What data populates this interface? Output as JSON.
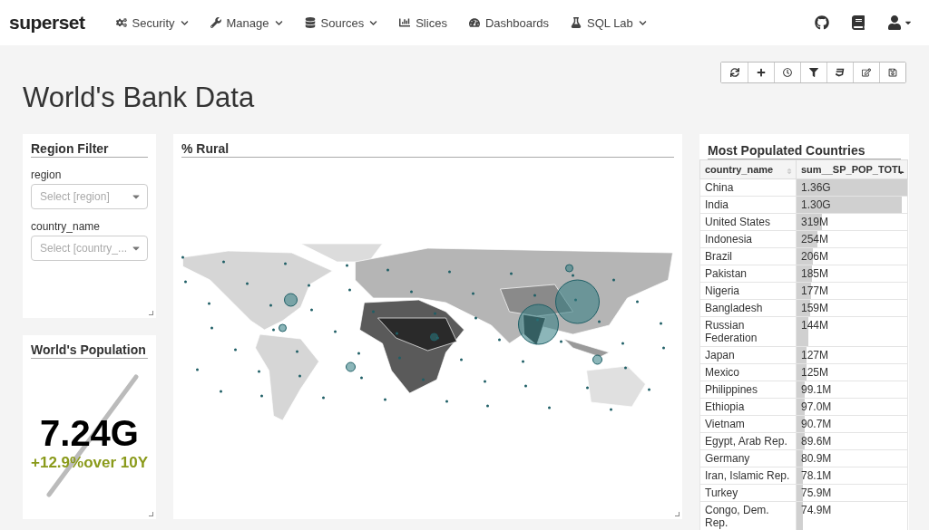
{
  "navbar": {
    "brand": "superset",
    "menu": [
      {
        "kind": "cogs",
        "label": "Security",
        "dropdown": true
      },
      {
        "kind": "wrench",
        "label": "Manage",
        "dropdown": true
      },
      {
        "kind": "database",
        "label": "Sources",
        "dropdown": true
      },
      {
        "kind": "chart",
        "label": "Slices",
        "dropdown": false
      },
      {
        "kind": "gauge",
        "label": "Dashboards",
        "dropdown": false
      },
      {
        "kind": "flask",
        "label": "SQL Lab",
        "dropdown": true
      }
    ]
  },
  "dashboard": {
    "title": "World's Bank Data"
  },
  "region_filter": {
    "title": "Region Filter",
    "fields": [
      {
        "label": "region",
        "placeholder": "Select [region]"
      },
      {
        "label": "country_name",
        "placeholder": "Select [country_..."
      }
    ]
  },
  "big_number": {
    "title": "World's Population",
    "value": "7.24G",
    "change": "+12.9%over 10Y"
  },
  "map": {
    "title": "% Rural"
  },
  "table": {
    "title": "Most Populated Countries",
    "columns": [
      "country_name",
      "sum__SP_POP_TOTL"
    ],
    "rows": [
      {
        "country": "China",
        "value": "1.36G",
        "level": 1
      },
      {
        "country": "India",
        "value": "1.30G",
        "level": 0.95
      },
      {
        "country": "United States",
        "value": "319M",
        "level": 0.23
      },
      {
        "country": "Indonesia",
        "value": "254M",
        "level": 0.19
      },
      {
        "country": "Brazil",
        "value": "206M",
        "level": 0.15
      },
      {
        "country": "Pakistan",
        "value": "185M",
        "level": 0.14
      },
      {
        "country": "Nigeria",
        "value": "177M",
        "level": 0.13
      },
      {
        "country": "Bangladesh",
        "value": "159M",
        "level": 0.12
      },
      {
        "country": "Russian Federation",
        "value": "144M",
        "level": 0.11
      },
      {
        "country": "Japan",
        "value": "127M",
        "level": 0.09
      },
      {
        "country": "Mexico",
        "value": "125M",
        "level": 0.09
      },
      {
        "country": "Philippines",
        "value": "99.1M",
        "level": 0.07
      },
      {
        "country": "Ethiopia",
        "value": "97.0M",
        "level": 0.07
      },
      {
        "country": "Vietnam",
        "value": "90.7M",
        "level": 0.07
      },
      {
        "country": "Egypt, Arab Rep.",
        "value": "89.6M",
        "level": 0.07
      },
      {
        "country": "Germany",
        "value": "80.9M",
        "level": 0.06
      },
      {
        "country": "Iran, Islamic Rep.",
        "value": "78.1M",
        "level": 0.06
      },
      {
        "country": "Turkey",
        "value": "75.9M",
        "level": 0.06
      },
      {
        "country": "Congo, Dem. Rep.",
        "value": "74.9M",
        "level": 0.06
      }
    ]
  }
}
